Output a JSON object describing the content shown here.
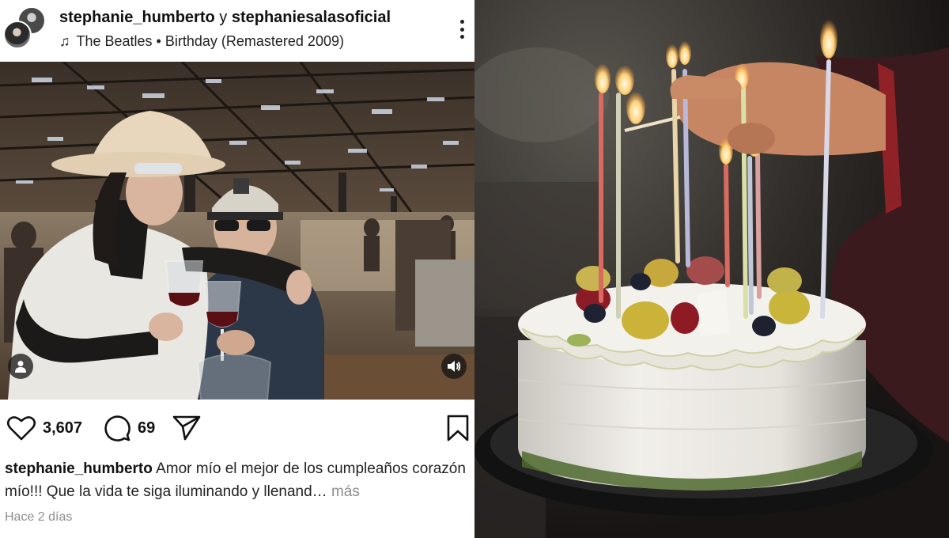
{
  "post": {
    "header": {
      "user_primary": "stephanie_humberto",
      "joiner": "y",
      "user_secondary": "stephaniesalasoficial",
      "music_icon": "music-note-icon",
      "music": "The Beatles • Birthday (Remastered 2009)",
      "more_icon": "more-vertical-icon"
    },
    "photo": {
      "user_tag_icon": "person-icon",
      "sound_icon": "speaker-icon"
    },
    "actions": {
      "likes": "3,607",
      "comments": "69",
      "like_icon": "heart-icon",
      "comment_icon": "comment-icon",
      "share_icon": "send-icon",
      "save_icon": "bookmark-icon"
    },
    "caption": {
      "user": "stephanie_humberto",
      "text": "Amor mío el mejor de los cumpleaños corazón mío!!! Que la vida te siga iluminando y llenand…",
      "more": "más"
    },
    "timestamp": "Hace 2 días"
  },
  "colors": {
    "text": "#111111",
    "muted": "#8e8e8e",
    "background": "#ffffff"
  }
}
